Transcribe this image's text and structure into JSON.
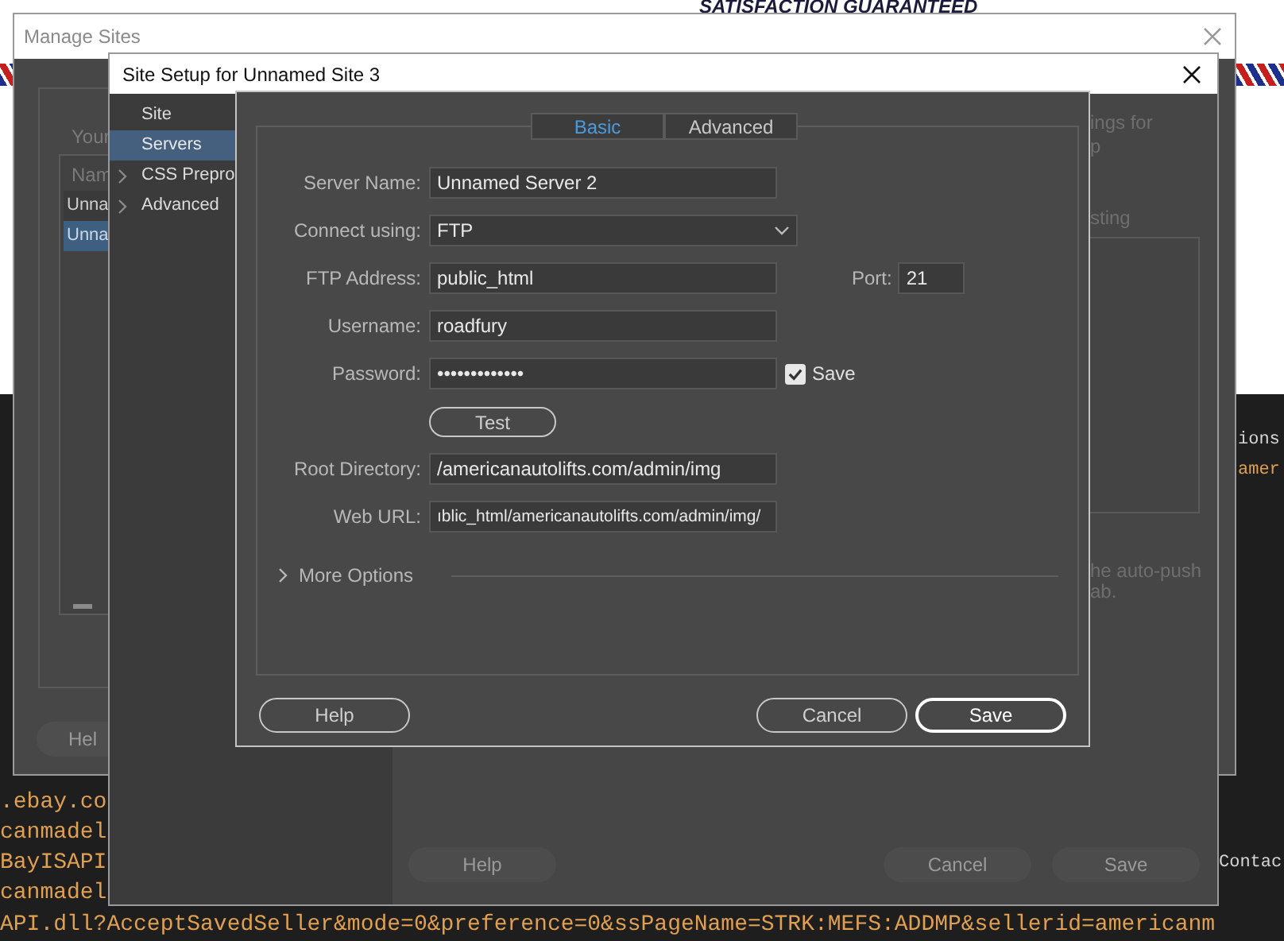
{
  "web_page": {
    "banner": "SATISFACTION GUARANTEED"
  },
  "code_editor": {
    "left_lines": [
      ".ebay.co",
      "canmadel",
      "BayISAPI",
      "canmadel"
    ],
    "right_lines": [
      {
        "text": "ions",
        "color": "#d4d4d4"
      },
      {
        "text": "amer",
        "color": "#e0a050"
      }
    ],
    "right_bottom": "Contac",
    "bottom_line": "API.dll?AcceptSavedSeller&mode=0&preference=0&ssPageName=STRK:MEFS:ADDMP&sellerid=americanm"
  },
  "manage_sites": {
    "title": "Manage Sites",
    "heading": "Your",
    "column": "Nam",
    "rows": [
      {
        "label": "Unna",
        "selected": false
      },
      {
        "label": "Unna",
        "selected": true
      }
    ],
    "help_button": "Hel"
  },
  "site_setup": {
    "title": "Site Setup for Unnamed Site 3",
    "sidebar": [
      {
        "label": "Site",
        "selected": false,
        "expandable": false
      },
      {
        "label": "Servers",
        "selected": true,
        "expandable": false
      },
      {
        "label": "CSS Prepro",
        "selected": false,
        "expandable": true
      },
      {
        "label": "Advanced",
        "selected": false,
        "expandable": true
      }
    ],
    "background_texts": [
      "ings for",
      "p",
      "sting",
      "he auto-push",
      "ab."
    ],
    "buttons": [
      "Help",
      "Cancel",
      "Save"
    ]
  },
  "server_dialog": {
    "tabs": [
      {
        "label": "Basic",
        "selected": true
      },
      {
        "label": "Advanced",
        "selected": false
      }
    ],
    "fields": [
      {
        "kind": "text",
        "label": "Server Name:",
        "value": "Unnamed Server 2"
      },
      {
        "kind": "select",
        "label": "Connect using:",
        "value": "FTP"
      },
      {
        "kind": "address",
        "label": "FTP Address:",
        "value": "public_html",
        "port_label": "Port:",
        "port_value": "21"
      },
      {
        "kind": "text",
        "label": "Username:",
        "value": "roadfury"
      },
      {
        "kind": "password",
        "label": "Password:",
        "value": "•••••••••••••",
        "save_label": "Save",
        "save_checked": true
      },
      {
        "kind": "button",
        "label": "Test"
      },
      {
        "kind": "text",
        "label": "Root Directory:",
        "value": "/americanautolifts.com/admin/img"
      },
      {
        "kind": "text",
        "label": "Web URL:",
        "value": "ıblic_html/americanautolifts.com/admin/img/"
      }
    ],
    "more_options": {
      "label": "More Options",
      "expanded": false
    },
    "buttons": [
      {
        "label": "Help",
        "primary": false
      },
      {
        "label": "Cancel",
        "primary": false
      },
      {
        "label": "Save",
        "primary": true
      }
    ]
  }
}
